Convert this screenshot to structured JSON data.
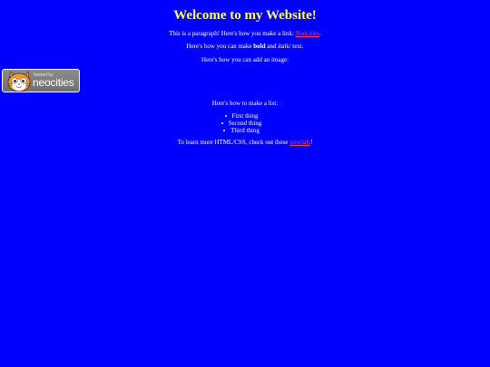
{
  "heading": "Welcome to my Website!",
  "p1": {
    "before": "This is a paragraph! Here's how you make a link: ",
    "link": "Neocities",
    "after": "."
  },
  "p2": {
    "before": "Here's how you can make ",
    "bold": "bold",
    "middle": " and ",
    "italic": "italic",
    "after": " text."
  },
  "p3": "Here's how you can add an image:",
  "p4": "Here's how to make a list:",
  "list": [
    "First thing",
    "Second thing",
    "Third thing"
  ],
  "p5": {
    "before": "To learn more HTML/CSS, check out these ",
    "link": "tutorials",
    "after": "!"
  },
  "badge": {
    "hosted": "hosted by",
    "brand": "neocities",
    "icon": "neocities-cat-icon"
  },
  "colors": {
    "background": "#0000fe",
    "heading": "#ffff55",
    "link": "#ff3b5c",
    "text": "#ffffff"
  }
}
